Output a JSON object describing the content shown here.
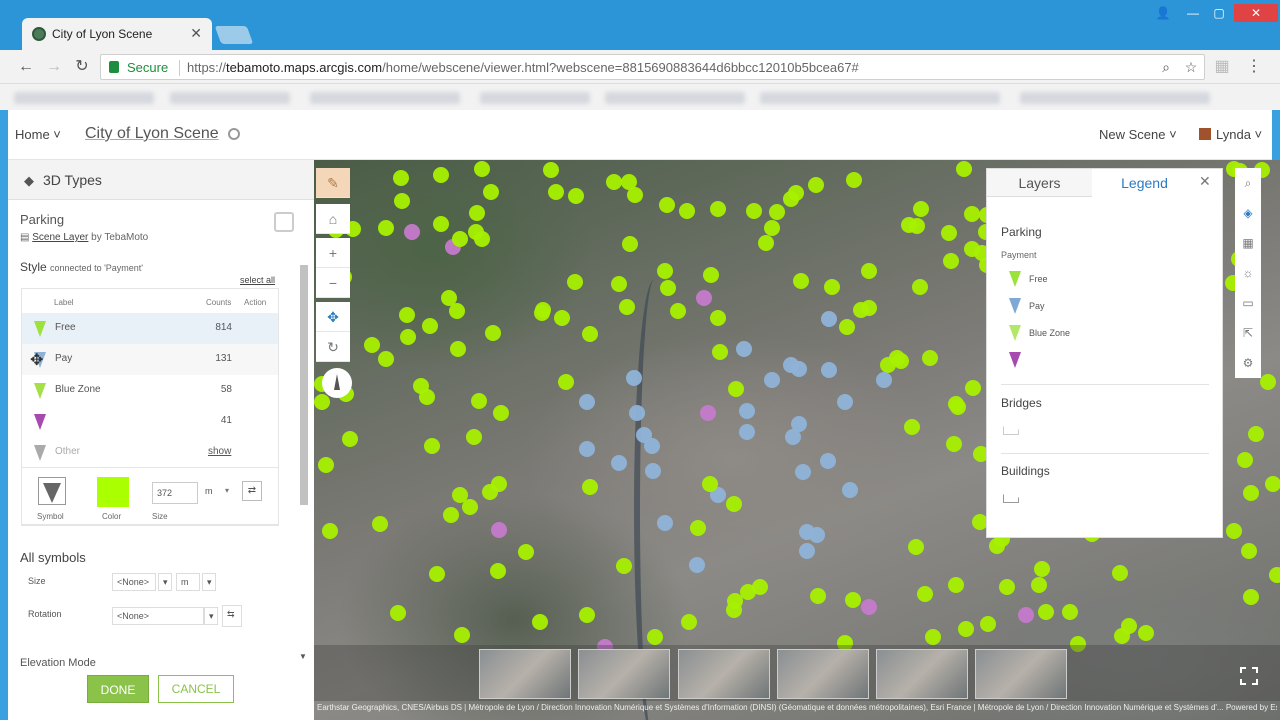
{
  "browser": {
    "tab_title": "City of Lyon Scene",
    "secure_label": "Secure",
    "url_scheme": "https://",
    "url_host": "tebamoto.maps.arcgis.com",
    "url_path": "/home/webscene/viewer.html?webscene=8815690883644d6bbcc12010b5bcea67#"
  },
  "header": {
    "home": "Home",
    "scene_title": "City of Lyon Scene",
    "new_scene": "New Scene",
    "user": "Lynda"
  },
  "left_panel": {
    "title": "3D Types",
    "layer_name": "Parking",
    "layer_type": "Scene Layer",
    "layer_owner": "by TebaMoto",
    "style_label": "Style",
    "style_connected": "connected to 'Payment'",
    "select_all": "select all",
    "columns": {
      "label": "Label",
      "counts": "Counts",
      "action": "Action"
    },
    "rows": [
      {
        "label": "Free",
        "count": "814",
        "color": "#9be23a"
      },
      {
        "label": "Pay",
        "count": "131",
        "color": "#8fb3d8"
      },
      {
        "label": "Blue Zone",
        "count": "58",
        "color": "#a6e048"
      },
      {
        "label": "",
        "count": "41",
        "color": "#a64ab0"
      },
      {
        "label": "Other",
        "count": "",
        "action": "show",
        "color": "#aaaaaa"
      }
    ],
    "editor": {
      "symbol_caption": "Symbol",
      "color_caption": "Color",
      "size_caption": "Size",
      "size_value": "372",
      "size_unit": "m"
    },
    "all_symbols": "All symbols",
    "size_label": "Size",
    "size_field": "<None>",
    "size_unit": "m",
    "rotation_label": "Rotation",
    "rotation_field": "<None>",
    "elevation_mode": "Elevation Mode",
    "done": "DONE",
    "cancel": "CANCEL"
  },
  "legend": {
    "tab_layers": "Layers",
    "tab_legend": "Legend",
    "parking": "Parking",
    "payment": "Payment",
    "items": [
      {
        "label": "Free",
        "color": "#9be23a"
      },
      {
        "label": "Pay",
        "color": "#7fa8d4"
      },
      {
        "label": "Blue Zone",
        "color": "#b2e86a"
      },
      {
        "label": "",
        "color": "#a64ab0"
      }
    ],
    "bridges": "Bridges",
    "buildings": "Buildings"
  },
  "attribution": "Earthstar Geographics, CNES/Airbus DS | Métropole de Lyon / Direction Innovation Numérique et Systèmes d'Information (DINSI) (Géomatique et données métropolitaines), Esri France | Métropole de Lyon / Direction Innovation Numérique et Systèmes d'...   Powered by Esri"
}
